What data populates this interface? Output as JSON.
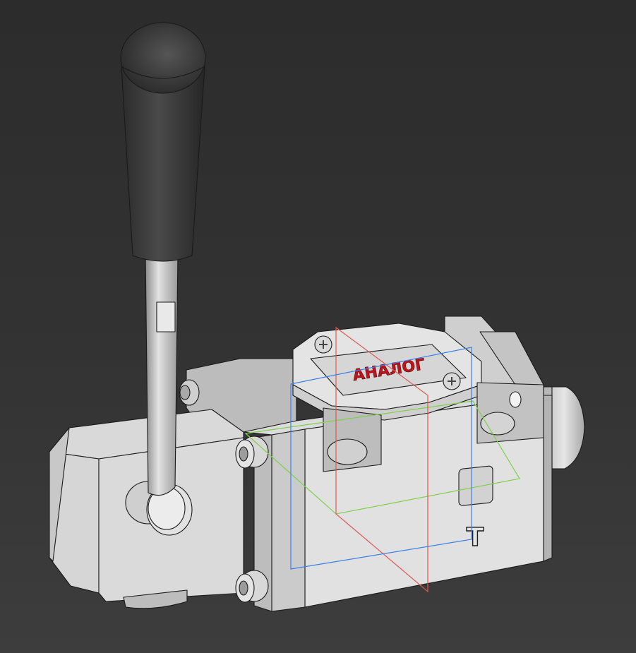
{
  "viewport": {
    "background_top": "#2c2c2c",
    "background_bottom": "#3d3d3d"
  },
  "model": {
    "nameplate_text": "АНАЛОГ",
    "nameplate_text_color": "#c0131c",
    "port_marking": "T",
    "body_color": "#d4d4d4",
    "handle_color": "#3a3a3a"
  },
  "work_planes": {
    "xy_plane_color": "#7fd14a",
    "xz_plane_color": "#e0584f",
    "yz_plane_color": "#3b82e6"
  }
}
